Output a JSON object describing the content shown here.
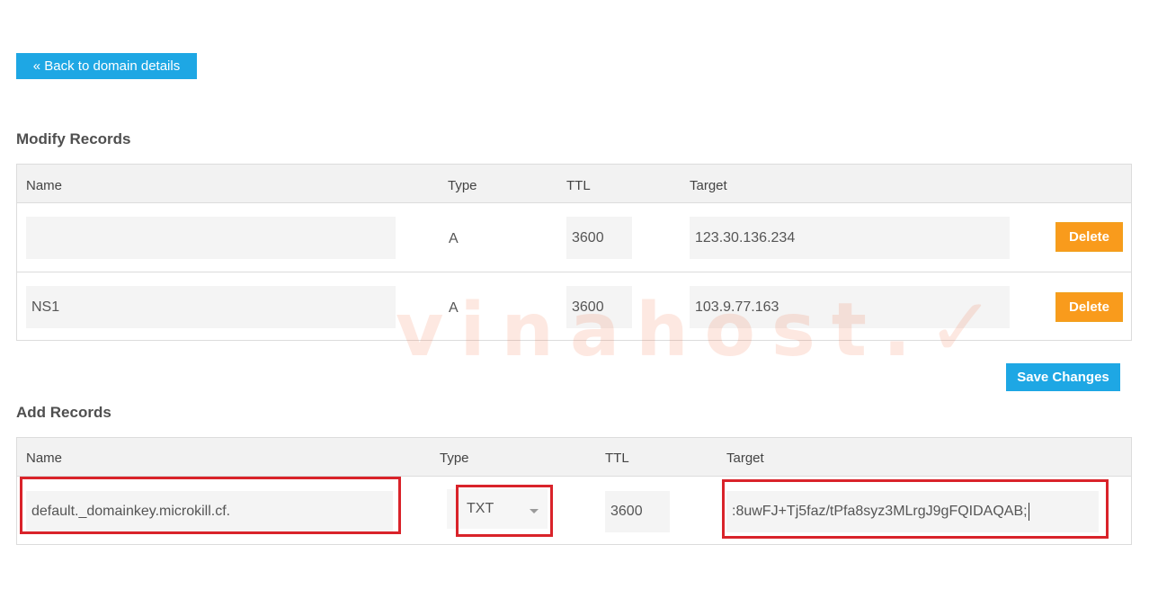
{
  "nav": {
    "back_label": "« Back to domain details"
  },
  "modify": {
    "title": "Modify Records",
    "headers": {
      "name": "Name",
      "type": "Type",
      "ttl": "TTL",
      "target": "Target"
    },
    "rows": [
      {
        "name": "",
        "type": "A",
        "ttl": "3600",
        "target": "123.30.136.234",
        "delete_label": "Delete"
      },
      {
        "name": "NS1",
        "type": "A",
        "ttl": "3600",
        "target": "103.9.77.163",
        "delete_label": "Delete"
      }
    ],
    "save_label": "Save Changes"
  },
  "add": {
    "title": "Add Records",
    "headers": {
      "name": "Name",
      "type": "Type",
      "ttl": "TTL",
      "target": "Target"
    },
    "row": {
      "name": "default._domainkey.microkill.cf.",
      "type": "TXT",
      "ttl": "3600",
      "target": ":8uwFJ+Tj5faz/tPfa8syz3MLrgJ9gFQIDAQAB;"
    }
  },
  "watermark": "vinahost.vn",
  "colors": {
    "accent_blue": "#1ea7e4",
    "delete_orange": "#f99b1c",
    "highlight_red": "#d9232a"
  }
}
